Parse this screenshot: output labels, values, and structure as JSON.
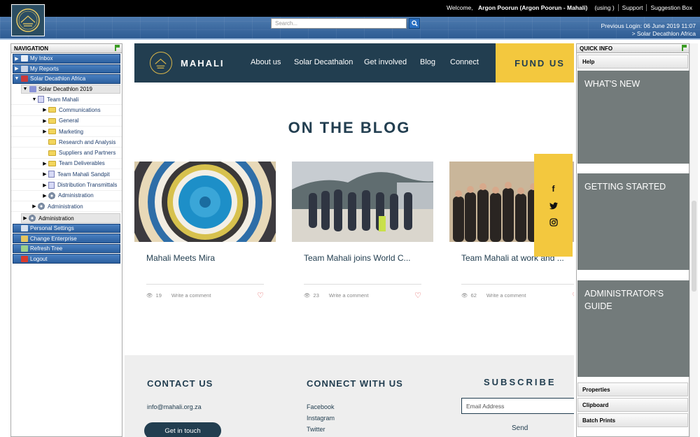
{
  "topbar": {
    "welcome_prefix": "Welcome,",
    "user": "Argon Poorun (Argon Poorun - Mahali)",
    "using": "(using )",
    "support": "Support",
    "suggestion": "Suggestion Box"
  },
  "banner": {
    "search_placeholder": "Search...",
    "previous_login": "Previous Login:  06 June 2019 11:07",
    "enterprise": ">  Solar Decathlon Africa"
  },
  "navigation": {
    "title": "NAVIGATION",
    "top_items": [
      "My Inbox",
      "My Reports",
      "Solar Decathlon Africa"
    ],
    "project": "Solar Decathlon 2019",
    "team": "Team Mahali",
    "team_children": [
      "Communications",
      "General",
      "Marketing",
      "Research and Analysis",
      "Suppliers and Partners",
      "Team Deliverables",
      "Team Mahali Sandpit",
      "Distribution Transmittals",
      "Administration"
    ],
    "project_admin": "Administration",
    "admin": "Administration",
    "bottom_items": [
      "Personal Settings",
      "Change Enterprise",
      "Refresh Tree",
      "Logout"
    ]
  },
  "site": {
    "brand": "MAHALI",
    "menu": [
      "About us",
      "Solar Decathalon",
      "Get involved",
      "Blog",
      "Connect"
    ],
    "fund": "FUND US",
    "blog_title": "ON THE BLOG",
    "posts": [
      {
        "title": "Mahali Meets Mira",
        "views": "19",
        "comment": "Write a comment"
      },
      {
        "title": "Team Mahali joins World C...",
        "views": "23",
        "comment": "Write a comment"
      },
      {
        "title": "Team Mahali at work and ...",
        "views": "62",
        "comment": "Write a comment"
      }
    ],
    "footer": {
      "contact_title": "CONTACT US",
      "email": "info@mahali.org.za",
      "get_in_touch": "Get in touch",
      "connect_title": "CONNECT WITH US",
      "links": [
        "Facebook",
        "Instagram",
        "Twitter"
      ],
      "subscribe_title": "SUBSCRIBE",
      "email_placeholder": "Email Address",
      "send": "Send"
    }
  },
  "quickinfo": {
    "title": "QUICK INFO",
    "help": "Help",
    "tiles": [
      "WHAT'S NEW",
      "GETTING STARTED",
      "ADMINISTRATOR'S GUIDE"
    ],
    "bottom": [
      "Properties",
      "Clipboard",
      "Batch Prints"
    ]
  },
  "colors": {
    "navy": "#223e50",
    "yellow": "#f3c83e",
    "nav_blue": "#2b5f9f",
    "tile_grey": "#737b7b"
  }
}
